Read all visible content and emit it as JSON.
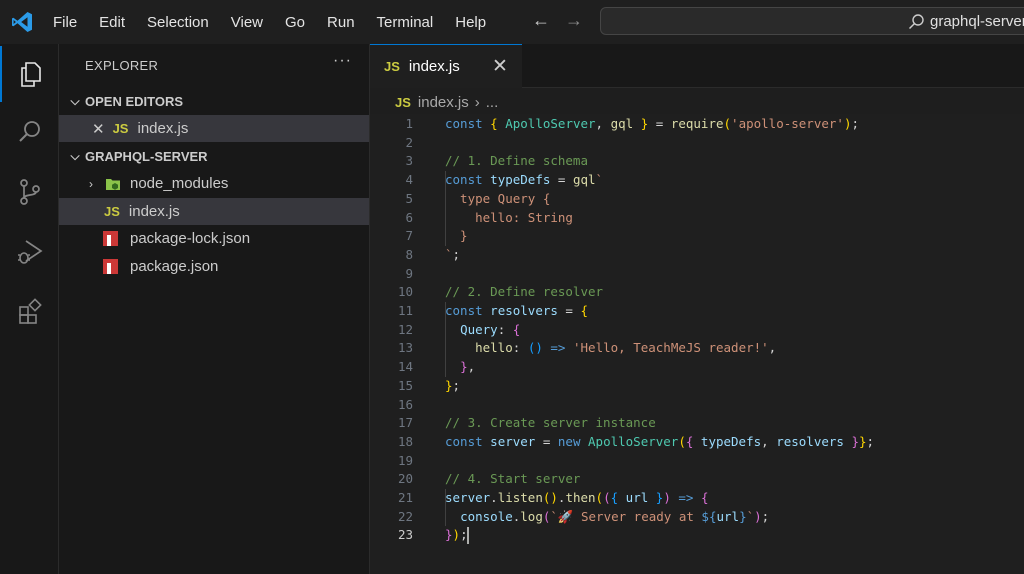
{
  "menu": [
    "File",
    "Edit",
    "Selection",
    "View",
    "Go",
    "Run",
    "Terminal",
    "Help"
  ],
  "search": {
    "text": "graphql-server"
  },
  "sidebar": {
    "title": "EXPLORER",
    "more": "···",
    "open_editors": {
      "label": "OPEN EDITORS",
      "items": [
        {
          "badge": "JS",
          "name": "index.js"
        }
      ]
    },
    "project": {
      "label": "GRAPHQL-SERVER",
      "items": [
        {
          "type": "folder",
          "name": "node_modules"
        },
        {
          "type": "js",
          "badge": "JS",
          "name": "index.js"
        },
        {
          "type": "npm",
          "name": "package-lock.json"
        },
        {
          "type": "npm",
          "name": "package.json"
        }
      ]
    }
  },
  "tab": {
    "badge": "JS",
    "label": "index.js",
    "close": "✕"
  },
  "breadcrumb": {
    "badge": "JS",
    "file": "index.js",
    "sep": "›",
    "rest": "..."
  },
  "editor": {
    "current_line": 23,
    "lines": [
      [
        [
          "kw",
          "const"
        ],
        [
          "op",
          " "
        ],
        [
          "p1",
          "{"
        ],
        [
          "op",
          " "
        ],
        [
          "cls",
          "ApolloServer"
        ],
        [
          "op",
          ", "
        ],
        [
          "fn",
          "gql"
        ],
        [
          "op",
          " "
        ],
        [
          "p1",
          "}"
        ],
        [
          "op",
          " = "
        ],
        [
          "fn",
          "require"
        ],
        [
          "p1",
          "("
        ],
        [
          "str",
          "'apollo-server'"
        ],
        [
          "p1",
          ")"
        ],
        [
          "op",
          ";"
        ]
      ],
      [],
      [
        [
          "com",
          "// 1. Define schema"
        ]
      ],
      [
        [
          "kw",
          "const"
        ],
        [
          "op",
          " "
        ],
        [
          "var",
          "typeDefs"
        ],
        [
          "op",
          " = "
        ],
        [
          "fn",
          "gql"
        ],
        [
          "str",
          "`"
        ]
      ],
      [
        [
          "str",
          "  type Query {"
        ]
      ],
      [
        [
          "str",
          "    hello: String"
        ]
      ],
      [
        [
          "str",
          "  }"
        ]
      ],
      [
        [
          "str",
          "`"
        ],
        [
          "op",
          ";"
        ]
      ],
      [],
      [
        [
          "com",
          "// 2. Define resolver"
        ]
      ],
      [
        [
          "kw",
          "const"
        ],
        [
          "op",
          " "
        ],
        [
          "var",
          "resolvers"
        ],
        [
          "op",
          " = "
        ],
        [
          "p1",
          "{"
        ]
      ],
      [
        [
          "op",
          "  "
        ],
        [
          "var",
          "Query"
        ],
        [
          "op",
          ": "
        ],
        [
          "p2",
          "{"
        ]
      ],
      [
        [
          "op",
          "    "
        ],
        [
          "fn",
          "hello"
        ],
        [
          "op",
          ": "
        ],
        [
          "p3",
          "()"
        ],
        [
          "op",
          " "
        ],
        [
          "kw",
          "=>"
        ],
        [
          "op",
          " "
        ],
        [
          "str",
          "'Hello, TeachMeJS reader!'"
        ],
        [
          "op",
          ","
        ]
      ],
      [
        [
          "op",
          "  "
        ],
        [
          "p2",
          "}"
        ],
        [
          "op",
          ","
        ]
      ],
      [
        [
          "p1",
          "}"
        ],
        [
          "op",
          ";"
        ]
      ],
      [],
      [
        [
          "com",
          "// 3. Create server instance"
        ]
      ],
      [
        [
          "kw",
          "const"
        ],
        [
          "op",
          " "
        ],
        [
          "var",
          "server"
        ],
        [
          "op",
          " = "
        ],
        [
          "kw",
          "new"
        ],
        [
          "op",
          " "
        ],
        [
          "cls",
          "ApolloServer"
        ],
        [
          "p1",
          "("
        ],
        [
          "p2",
          "{"
        ],
        [
          "op",
          " "
        ],
        [
          "var",
          "typeDefs"
        ],
        [
          "op",
          ", "
        ],
        [
          "var",
          "resolvers"
        ],
        [
          "op",
          " "
        ],
        [
          "p2",
          "}"
        ],
        [
          "p1",
          "}"
        ],
        [
          "op",
          ";"
        ]
      ],
      [],
      [
        [
          "com",
          "// 4. Start server"
        ]
      ],
      [
        [
          "var",
          "server"
        ],
        [
          "op",
          "."
        ],
        [
          "fn",
          "listen"
        ],
        [
          "p1",
          "()"
        ],
        [
          "op",
          "."
        ],
        [
          "fn",
          "then"
        ],
        [
          "p1",
          "("
        ],
        [
          "p2",
          "("
        ],
        [
          "p3",
          "{"
        ],
        [
          "op",
          " "
        ],
        [
          "var",
          "url"
        ],
        [
          "op",
          " "
        ],
        [
          "p3",
          "}"
        ],
        [
          "p2",
          ")"
        ],
        [
          "op",
          " "
        ],
        [
          "kw",
          "=>"
        ],
        [
          "op",
          " "
        ],
        [
          "p2",
          "{"
        ]
      ],
      [
        [
          "op",
          "  "
        ],
        [
          "var",
          "console"
        ],
        [
          "op",
          "."
        ],
        [
          "fn",
          "log"
        ],
        [
          "p2",
          "("
        ],
        [
          "str",
          "`🚀 Server ready at "
        ],
        [
          "kw",
          "${"
        ],
        [
          "var",
          "url"
        ],
        [
          "kw",
          "}"
        ],
        [
          "str",
          "`"
        ],
        [
          "p2",
          ")"
        ],
        [
          "op",
          ";"
        ]
      ],
      [
        [
          "p2",
          "}"
        ],
        [
          "p1",
          ")"
        ],
        [
          "op",
          ";"
        ]
      ]
    ]
  }
}
